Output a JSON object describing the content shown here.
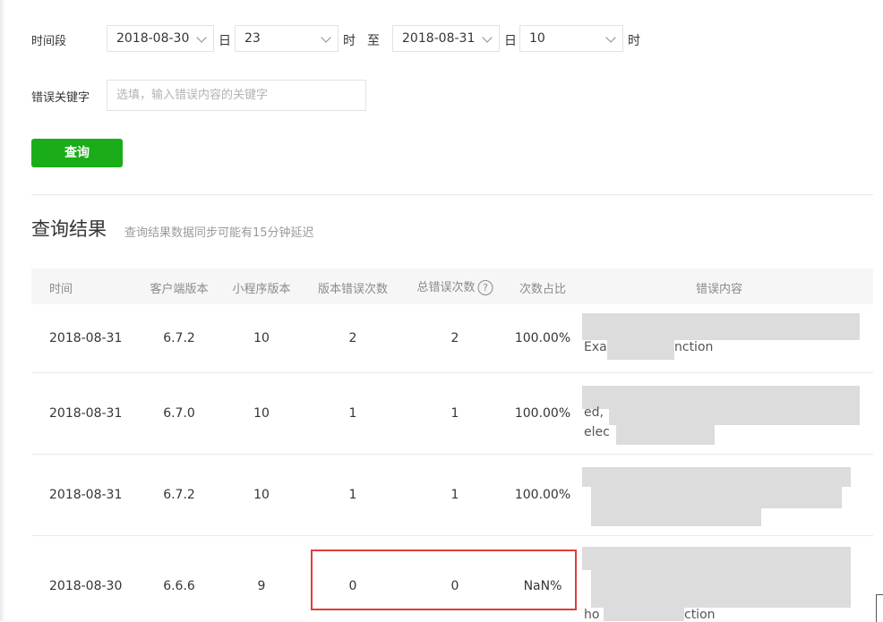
{
  "filters": {
    "period_label": "时间段",
    "start_date": "2018-08-30",
    "day_unit": "日",
    "start_hour": "23",
    "hour_unit": "时",
    "to_label": "至",
    "end_date": "2018-08-31",
    "end_hour": "10",
    "keyword_label": "错误关键字",
    "keyword_placeholder": "选填，输入错误内容的关键字",
    "query_button": "查询"
  },
  "results": {
    "title": "查询结果",
    "note": "查询结果数据同步可能有15分钟延迟"
  },
  "table": {
    "headers": {
      "time": "时间",
      "client_version": "客户端版本",
      "miniprogram_version": "小程序版本",
      "version_error_count": "版本错误次数",
      "total_error_count": "总错误次数",
      "help_icon": "?",
      "ratio": "次数占比",
      "error_content": "错误内容"
    },
    "rows": [
      {
        "time": "2018-08-31",
        "client": "6.7.2",
        "mini": "10",
        "version_errors": "2",
        "total_errors": "2",
        "ratio": "100.00%",
        "error_fragments": [
          "Exa",
          "nction"
        ]
      },
      {
        "time": "2018-08-31",
        "client": "6.7.0",
        "mini": "10",
        "version_errors": "1",
        "total_errors": "1",
        "ratio": "100.00%",
        "error_fragments": [
          "ed,",
          "elec"
        ]
      },
      {
        "time": "2018-08-31",
        "client": "6.7.2",
        "mini": "10",
        "version_errors": "1",
        "total_errors": "1",
        "ratio": "100.00%",
        "error_fragments": []
      },
      {
        "time": "2018-08-30",
        "client": "6.6.6",
        "mini": "9",
        "version_errors": "0",
        "total_errors": "0",
        "ratio": "NaN%",
        "error_fragments": [
          "ho",
          "ction"
        ]
      }
    ]
  },
  "colors": {
    "primary_button": "#1aad19",
    "highlight_box": "#e03c3c",
    "header_bg": "#f6f6f6"
  }
}
